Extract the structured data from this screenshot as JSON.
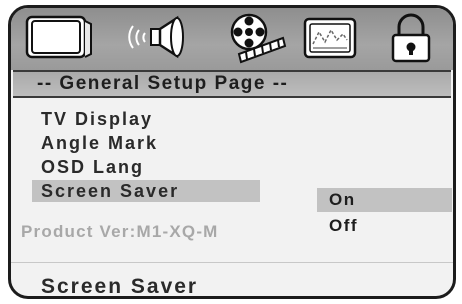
{
  "tabs": [
    {
      "icon": "tv-icon"
    },
    {
      "icon": "speaker-icon"
    },
    {
      "icon": "film-reel-icon"
    },
    {
      "icon": "preference-panel-icon"
    },
    {
      "icon": "lock-icon"
    }
  ],
  "header": {
    "title": "-- General Setup Page --"
  },
  "menu": {
    "items": [
      {
        "label": "TV Display"
      },
      {
        "label": "Angle Mark"
      },
      {
        "label": "OSD Lang"
      },
      {
        "label": "Screen Saver"
      }
    ],
    "selected_index": 3
  },
  "product_version": "Product Ver:M1-XQ-M",
  "options": [
    {
      "label": "On",
      "highlighted": true
    },
    {
      "label": "Off",
      "highlighted": false
    }
  ],
  "status_text": "Screen Saver"
}
